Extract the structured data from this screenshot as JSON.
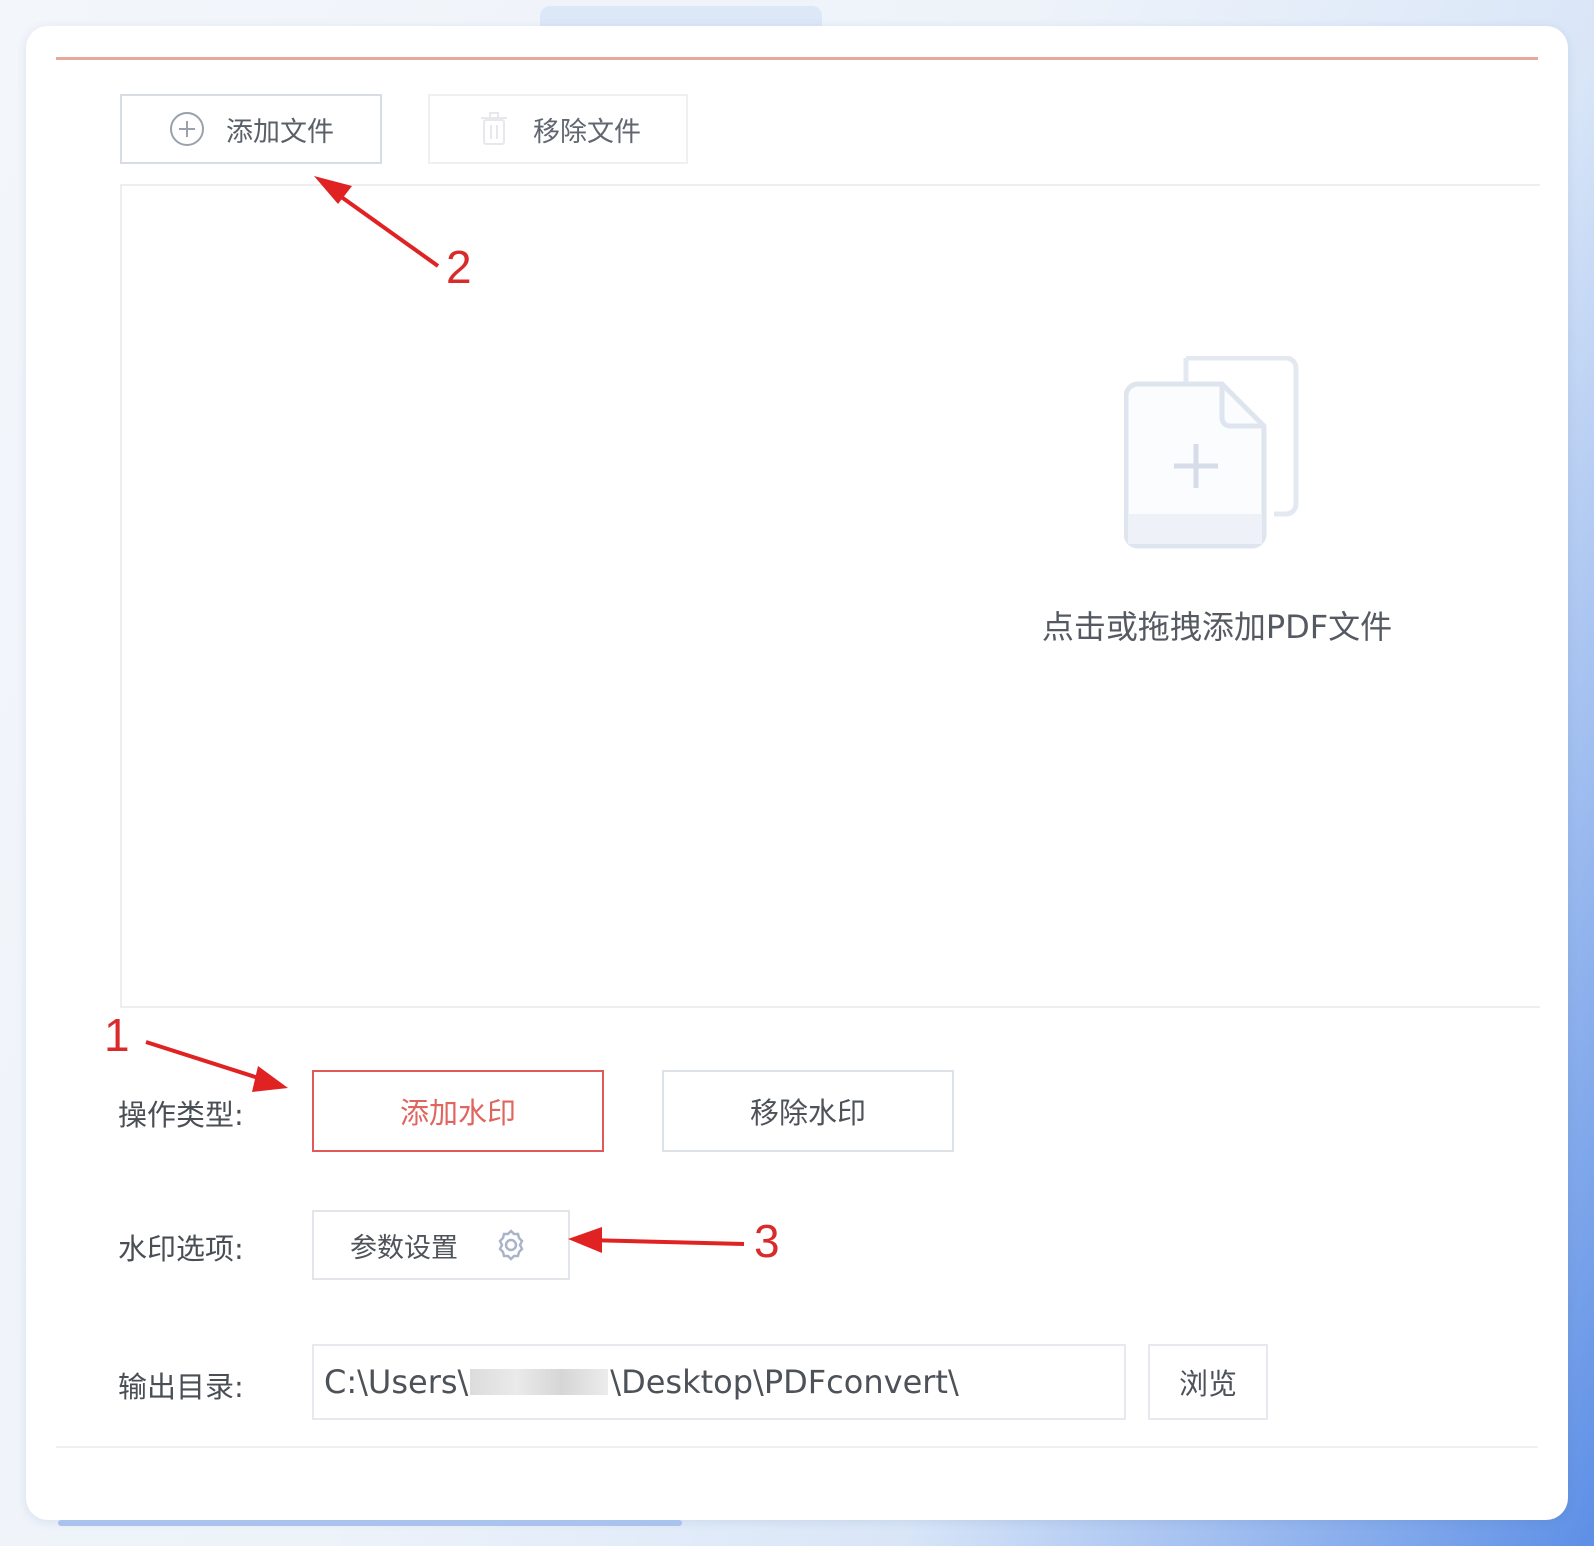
{
  "toolbar": {
    "add_file_label": "添加文件",
    "remove_file_label": "移除文件"
  },
  "dropzone": {
    "hint": "点击或拖拽添加PDF文件"
  },
  "operation": {
    "label": "操作类型:",
    "options": [
      "添加水印",
      "移除水印"
    ],
    "selected": "添加水印"
  },
  "watermark": {
    "label": "水印选项:",
    "param_button": "参数设置"
  },
  "output": {
    "label": "输出目录:",
    "path_prefix": "C:\\Users\\",
    "path_suffix": "\\Desktop\\PDFconvert\\",
    "browse_label": "浏览"
  },
  "annotations": {
    "n1": "1",
    "n2": "2",
    "n3": "3"
  },
  "colors": {
    "accent_red": "#e05a5a",
    "annotation_red": "#d92b2b",
    "icon_gray": "#b7bdc8"
  }
}
